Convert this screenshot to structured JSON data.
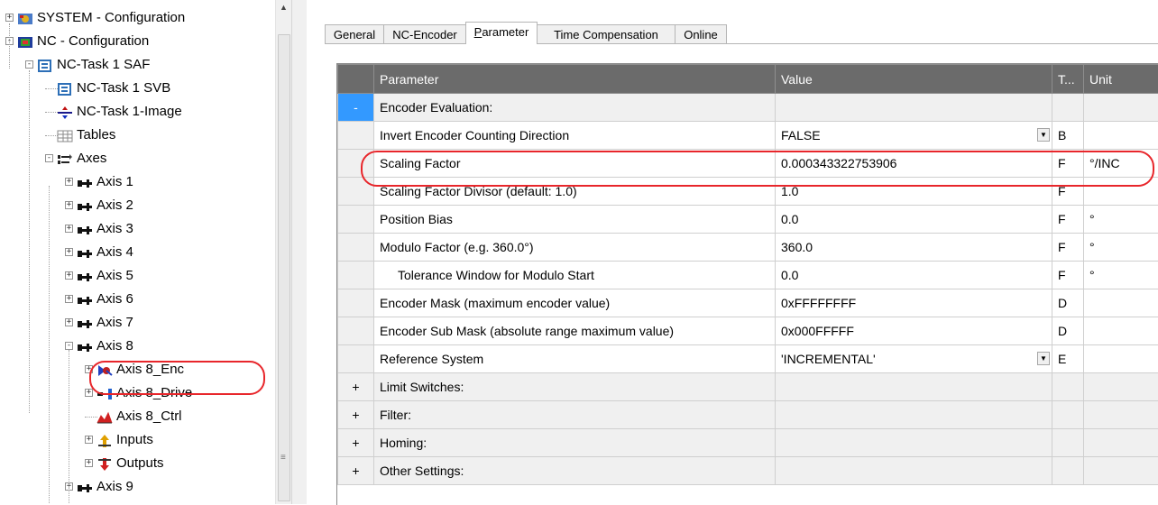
{
  "tree": {
    "items": [
      {
        "label": "SYSTEM - Configuration",
        "icon": "system-config-icon",
        "expander": "+"
      },
      {
        "label": "NC - Configuration",
        "icon": "nc-config-icon",
        "expander": "-"
      },
      {
        "label": "NC-Task 1 SAF",
        "icon": "task-icon",
        "expander": "-"
      },
      {
        "label": "NC-Task 1 SVB",
        "icon": "task-icon",
        "expander": ""
      },
      {
        "label": "NC-Task 1-Image",
        "icon": "image-icon",
        "expander": ""
      },
      {
        "label": "Tables",
        "icon": "table-icon",
        "expander": ""
      },
      {
        "label": "Axes",
        "icon": "axes-icon",
        "expander": "-"
      },
      {
        "label": "Axis 1",
        "icon": "axis-icon",
        "expander": "+"
      },
      {
        "label": "Axis 2",
        "icon": "axis-icon",
        "expander": "+"
      },
      {
        "label": "Axis 3",
        "icon": "axis-icon",
        "expander": "+"
      },
      {
        "label": "Axis 4",
        "icon": "axis-icon",
        "expander": "+"
      },
      {
        "label": "Axis 5",
        "icon": "axis-icon",
        "expander": "+"
      },
      {
        "label": "Axis 6",
        "icon": "axis-icon",
        "expander": "+"
      },
      {
        "label": "Axis 7",
        "icon": "axis-icon",
        "expander": "+"
      },
      {
        "label": "Axis 8",
        "icon": "axis-icon",
        "expander": "-"
      },
      {
        "label": "Axis 8_Enc",
        "icon": "encoder-icon",
        "expander": "+"
      },
      {
        "label": "Axis 8_Drive",
        "icon": "drive-icon",
        "expander": "+"
      },
      {
        "label": "Axis 8_Ctrl",
        "icon": "controller-icon",
        "expander": ""
      },
      {
        "label": "Inputs",
        "icon": "inputs-icon",
        "expander": "+"
      },
      {
        "label": "Outputs",
        "icon": "outputs-icon",
        "expander": "+"
      },
      {
        "label": "Axis 9",
        "icon": "axis-icon",
        "expander": "+"
      }
    ]
  },
  "tabs": [
    {
      "label": "General",
      "active": false
    },
    {
      "label": "NC-Encoder",
      "active": false
    },
    {
      "label": "Parameter",
      "active": true
    },
    {
      "label": "Time Compensation",
      "active": false
    },
    {
      "label": "Online",
      "active": false
    }
  ],
  "grid": {
    "headers": {
      "parameter": "Parameter",
      "value": "Value",
      "type": "T...",
      "unit": "Unit"
    },
    "rows": [
      {
        "gutter": "-",
        "parameter": "Encoder Evaluation:",
        "value": "",
        "type": "",
        "unit": "",
        "group": true,
        "selected_gutter": true
      },
      {
        "gutter": "",
        "parameter": "Invert Encoder Counting Direction",
        "value": "FALSE",
        "type": "B",
        "unit": "",
        "dropdown": true
      },
      {
        "gutter": "",
        "parameter": "Scaling Factor",
        "value": "0.000343322753906",
        "type": "F",
        "unit": "°/INC"
      },
      {
        "gutter": "",
        "parameter": "Scaling Factor Divisor (default: 1.0)",
        "value": "1.0",
        "type": "F",
        "unit": ""
      },
      {
        "gutter": "",
        "parameter": "Position Bias",
        "value": "0.0",
        "type": "F",
        "unit": "°"
      },
      {
        "gutter": "",
        "parameter": "Modulo Factor (e.g. 360.0°)",
        "value": "360.0",
        "type": "F",
        "unit": "°"
      },
      {
        "gutter": "",
        "parameter": "Tolerance Window for Modulo Start",
        "value": "0.0",
        "type": "F",
        "unit": "°",
        "indent": true
      },
      {
        "gutter": "",
        "parameter": "Encoder Mask (maximum encoder value)",
        "value": "0xFFFFFFFF",
        "type": "D",
        "unit": ""
      },
      {
        "gutter": "",
        "parameter": "Encoder Sub Mask (absolute range maximum value)",
        "value": "0x000FFFFF",
        "type": "D",
        "unit": ""
      },
      {
        "gutter": "",
        "parameter": "Reference System",
        "value": "'INCREMENTAL'",
        "type": "E",
        "unit": "",
        "dropdown": true
      },
      {
        "gutter": "+",
        "parameter": "Limit Switches:",
        "value": "",
        "type": "",
        "unit": "",
        "group": true
      },
      {
        "gutter": "+",
        "parameter": "Filter:",
        "value": "",
        "type": "",
        "unit": "",
        "group": true
      },
      {
        "gutter": "+",
        "parameter": "Homing:",
        "value": "",
        "type": "",
        "unit": "",
        "group": true
      },
      {
        "gutter": "+",
        "parameter": "Other Settings:",
        "value": "",
        "type": "",
        "unit": "",
        "group": true
      }
    ]
  },
  "colors": {
    "highlight": "#e8262b",
    "header_bg": "#6b6b6b",
    "selection": "#3399ff"
  }
}
